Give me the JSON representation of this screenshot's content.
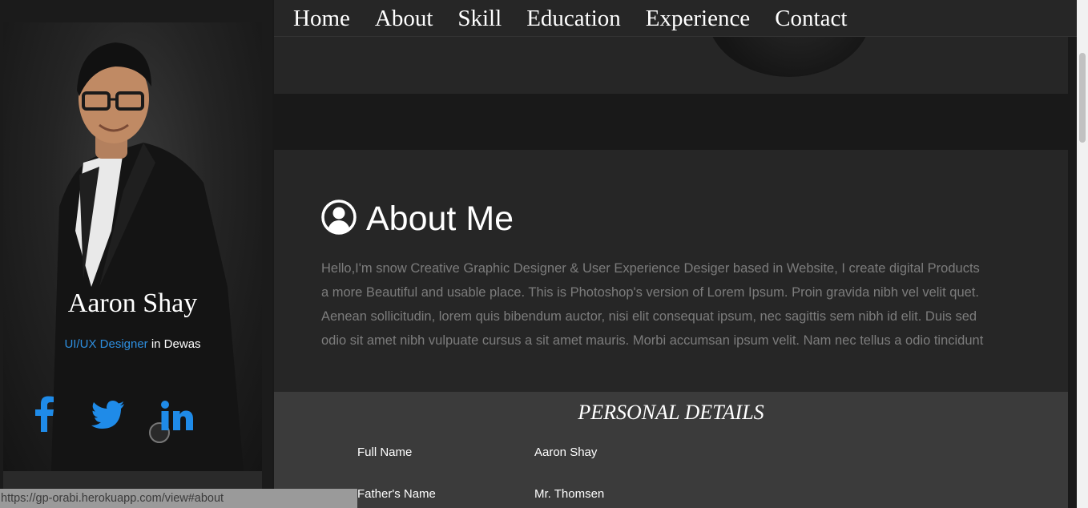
{
  "nav": {
    "items": [
      {
        "label": "Home"
      },
      {
        "label": "About"
      },
      {
        "label": "Skill"
      },
      {
        "label": "Education"
      },
      {
        "label": "Experience"
      },
      {
        "label": "Contact"
      }
    ]
  },
  "profile": {
    "name": "Aaron Shay",
    "role": "UI/UX Designer",
    "location_text": " in Dewas",
    "social": [
      {
        "icon": "facebook-icon",
        "color": "#1f8be8"
      },
      {
        "icon": "twitter-icon",
        "color": "#1f8be8"
      },
      {
        "icon": "linkedin-icon",
        "color": "#1f8be8"
      }
    ]
  },
  "about": {
    "icon": "user-circle-icon",
    "title": "About Me",
    "text": "Hello,I'm snow Creative Graphic Designer & User Experience Desiger based in Website, I create digital Products a more Beautiful and usable place. This is Photoshop's version of Lorem Ipsum. Proin gravida nibh vel velit quet. Aenean sollicitudin, lorem quis bibendum auctor, nisi elit consequat ipsum, nec sagittis sem nibh id elit. Duis sed odio sit amet nibh vulpuate cursus a sit amet mauris. Morbi accumsan ipsum velit. Nam nec tellus a odio tincidunt"
  },
  "personal_details": {
    "title": "PERSONAL DETAILS",
    "rows": [
      {
        "label": "Full Name",
        "value": "Aaron Shay"
      },
      {
        "label": "Father's Name",
        "value": "Mr. Thomsen"
      }
    ]
  },
  "status_bar": {
    "url": "https://gp-orabi.herokuapp.com/view#about"
  },
  "colors": {
    "accent": "#2e8fe0",
    "background": "#191919",
    "card": "#262626",
    "details_card": "#3b3b3b"
  }
}
